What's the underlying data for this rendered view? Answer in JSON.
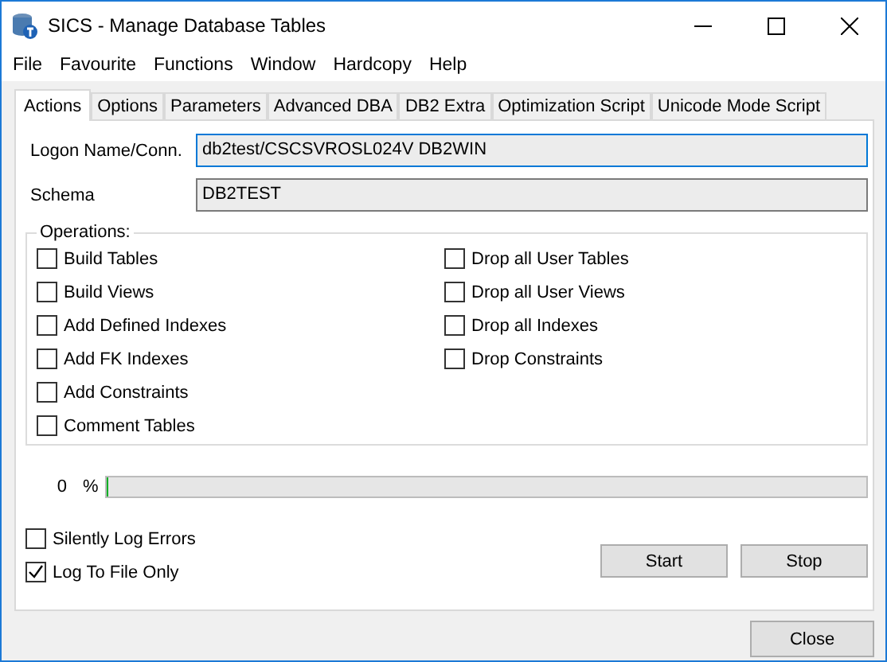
{
  "window": {
    "title": "SICS - Manage Database Tables"
  },
  "menu": [
    "File",
    "Favourite",
    "Functions",
    "Window",
    "Hardcopy",
    "Help"
  ],
  "tabs": [
    {
      "label": "Actions",
      "selected": true
    },
    {
      "label": "Options",
      "selected": false
    },
    {
      "label": "Parameters",
      "selected": false
    },
    {
      "label": "Advanced DBA",
      "selected": false
    },
    {
      "label": "DB2 Extra",
      "selected": false
    },
    {
      "label": "Optimization Script",
      "selected": false
    },
    {
      "label": "Unicode Mode Script",
      "selected": false
    }
  ],
  "fields": [
    {
      "label": "Logon Name/Conn.",
      "value": "db2test/CSCSVROSL024V DB2WIN",
      "focused": true
    },
    {
      "label": "Schema",
      "value": "DB2TEST",
      "focused": false
    }
  ],
  "operations": {
    "title": "Operations:",
    "left": [
      {
        "label": "Build Tables",
        "checked": false
      },
      {
        "label": "Build Views",
        "checked": false
      },
      {
        "label": "Add Defined Indexes",
        "checked": false
      },
      {
        "label": "Add FK Indexes",
        "checked": false
      },
      {
        "label": "Add Constraints",
        "checked": false
      },
      {
        "label": "Comment Tables",
        "checked": false
      }
    ],
    "right": [
      {
        "label": "Drop all User Tables",
        "checked": false
      },
      {
        "label": "Drop all User Views",
        "checked": false
      },
      {
        "label": "Drop all Indexes",
        "checked": false
      },
      {
        "label": "Drop Constraints",
        "checked": false
      }
    ]
  },
  "progress": {
    "value": "0",
    "unit": "%",
    "level": 0
  },
  "options": [
    {
      "label": "Silently Log Errors",
      "checked": false
    },
    {
      "label": "Log To File Only",
      "checked": true
    }
  ],
  "buttons": [
    "Start",
    "Stop"
  ],
  "close_button": "Close"
}
